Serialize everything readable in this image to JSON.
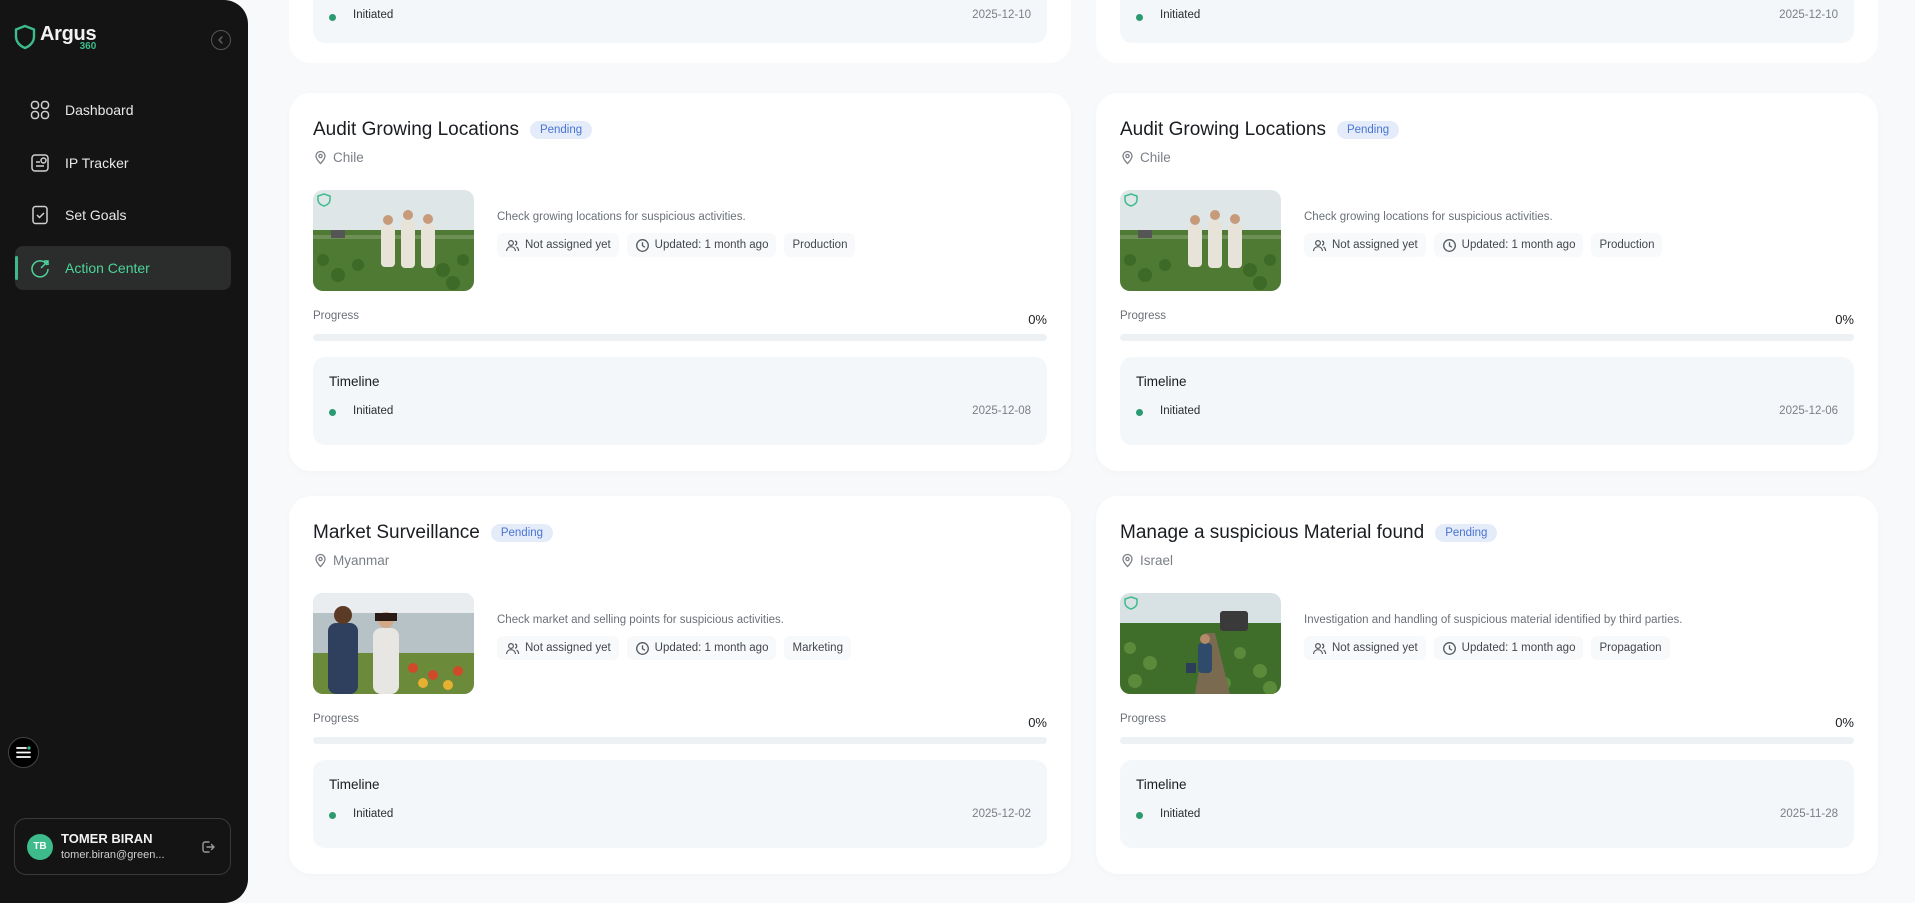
{
  "brand": {
    "name": "Argus",
    "sub": "360"
  },
  "nav": [
    {
      "label": "Dashboard",
      "icon": "grid-icon",
      "active": false
    },
    {
      "label": "IP Tracker",
      "icon": "tracker-icon",
      "active": false
    },
    {
      "label": "Set Goals",
      "icon": "goals-icon",
      "active": false
    },
    {
      "label": "Action Center",
      "icon": "action-center-icon",
      "active": true
    }
  ],
  "user": {
    "initials": "TB",
    "name": "TOMER BIRAN",
    "email": "tomer.biran@green..."
  },
  "colors": {
    "accent": "#3dbb8a",
    "badge_bg": "#e4ecfa",
    "badge_text": "#4a74d0",
    "sidebar": "#141414"
  },
  "partial_cards": [
    {
      "status": "Initiated",
      "date": "2025-12-10"
    },
    {
      "status": "Initiated",
      "date": "2025-12-10"
    }
  ],
  "cards": [
    {
      "title": "Audit Growing Locations",
      "badge": "Pending",
      "location": "Chile",
      "description": "Check growing locations for suspicious activities.",
      "assignee": "Not assigned yet",
      "updated": "Updated: 1 month ago",
      "category": "Production",
      "progress_label": "Progress",
      "progress_value": "0%",
      "progress": 0,
      "timeline_title": "Timeline",
      "timeline_status": "Initiated",
      "timeline_date": "2025-12-08"
    },
    {
      "title": "Audit Growing Locations",
      "badge": "Pending",
      "location": "Chile",
      "description": "Check growing locations for suspicious activities.",
      "assignee": "Not assigned yet",
      "updated": "Updated: 1 month ago",
      "category": "Production",
      "progress_label": "Progress",
      "progress_value": "0%",
      "progress": 0,
      "timeline_title": "Timeline",
      "timeline_status": "Initiated",
      "timeline_date": "2025-12-06"
    },
    {
      "title": "Market Surveillance",
      "badge": "Pending",
      "location": "Myanmar",
      "description": "Check market and selling points for suspicious activities.",
      "assignee": "Not assigned yet",
      "updated": "Updated: 1 month ago",
      "category": "Marketing",
      "progress_label": "Progress",
      "progress_value": "0%",
      "progress": 0,
      "timeline_title": "Timeline",
      "timeline_status": "Initiated",
      "timeline_date": "2025-12-02"
    },
    {
      "title": "Manage a suspicious Material found",
      "badge": "Pending",
      "location": "Israel",
      "description": "Investigation and handling of suspicious material identified by third parties.",
      "assignee": "Not assigned yet",
      "updated": "Updated: 1 month ago",
      "category": "Propagation",
      "progress_label": "Progress",
      "progress_value": "0%",
      "progress": 0,
      "timeline_title": "Timeline",
      "timeline_status": "Initiated",
      "timeline_date": "2025-11-28"
    }
  ]
}
